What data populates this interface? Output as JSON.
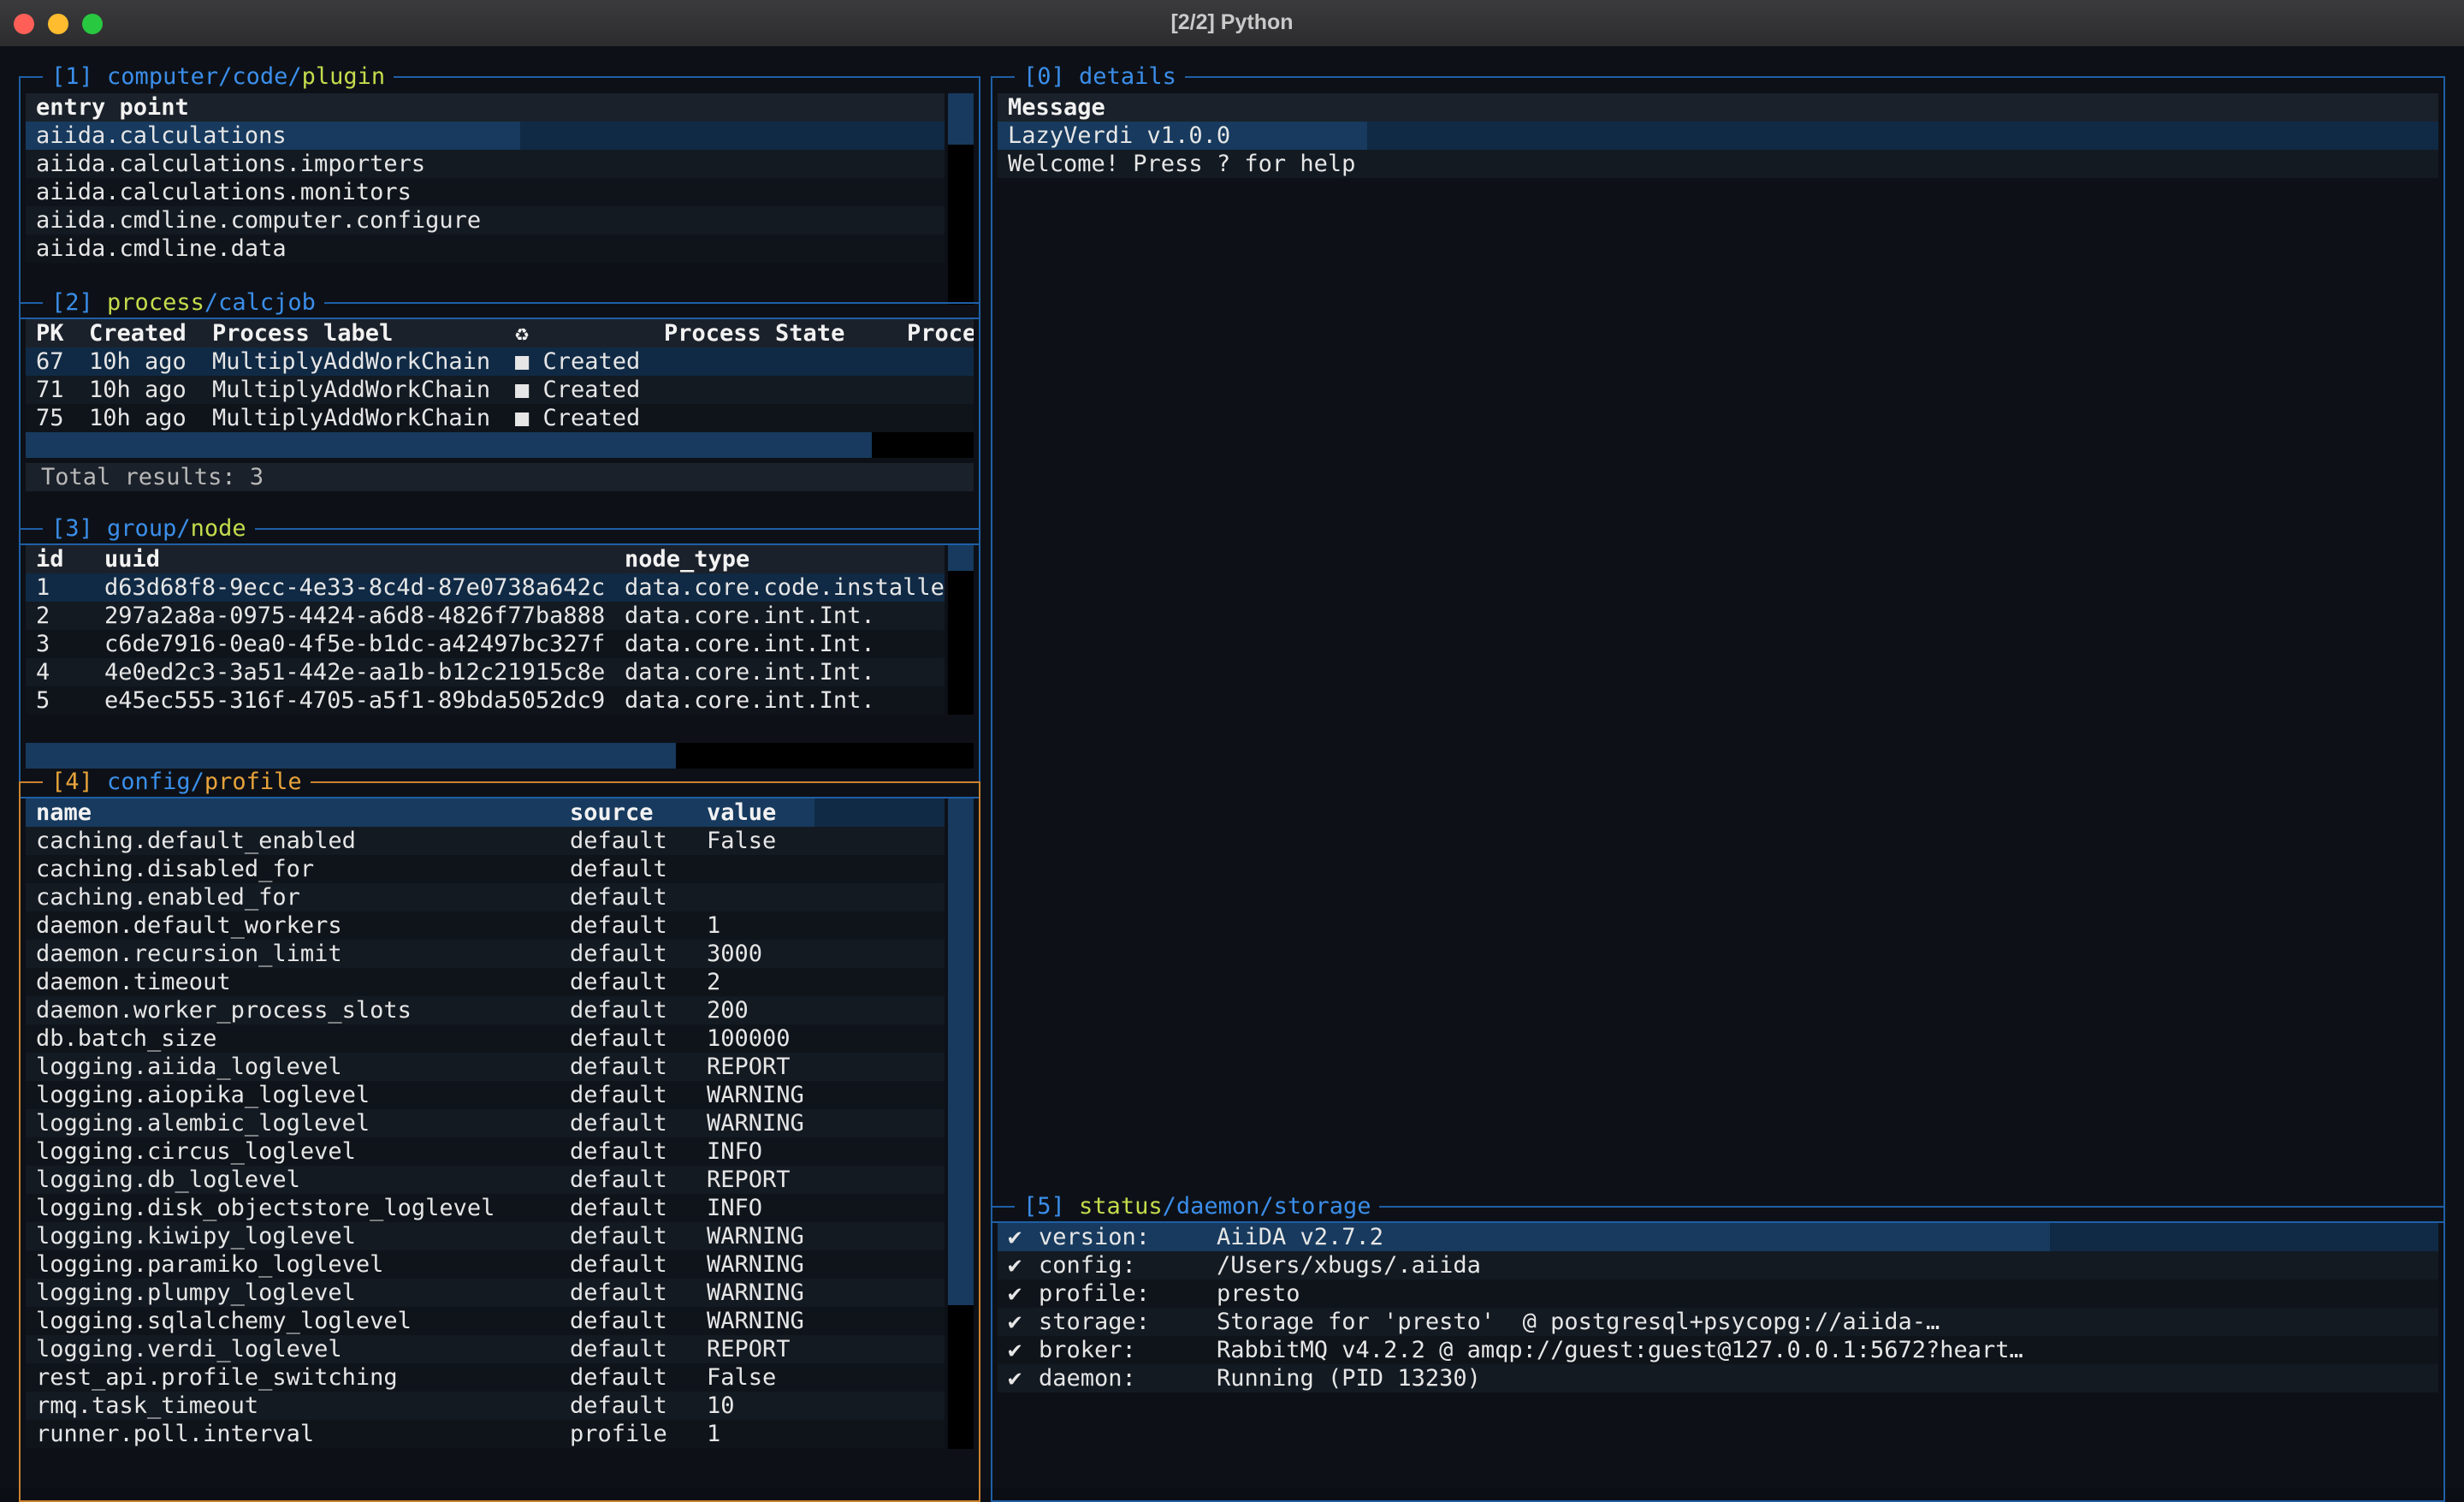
{
  "window": {
    "title": "[2/2] Python"
  },
  "panels": {
    "plugin": {
      "index": "[1]",
      "path": [
        "computer",
        "code",
        "plugin"
      ],
      "header": "entry point",
      "rows": [
        "aiida.calculations",
        "aiida.calculations.importers",
        "aiida.calculations.monitors",
        "aiida.cmdline.computer.configure",
        "aiida.cmdline.data"
      ]
    },
    "process": {
      "index": "[2]",
      "path": [
        "process",
        "calcjob"
      ],
      "columns": [
        "PK",
        "Created",
        "Process label",
        "♻",
        "Process State",
        "Process"
      ],
      "rows": [
        {
          "pk": "67",
          "created": "10h ago",
          "label": "MultiplyAddWorkChain",
          "state": "■ Created"
        },
        {
          "pk": "71",
          "created": "10h ago",
          "label": "MultiplyAddWorkChain",
          "state": "■ Created"
        },
        {
          "pk": "75",
          "created": "10h ago",
          "label": "MultiplyAddWorkChain",
          "state": "■ Created"
        }
      ],
      "total": "Total results: 3"
    },
    "group": {
      "index": "[3]",
      "path": [
        "group",
        "node"
      ],
      "columns": [
        "id",
        "uuid",
        "node_type"
      ],
      "rows": [
        {
          "id": "1",
          "uuid": "d63d68f8-9ecc-4e33-8c4d-87e0738a642c",
          "type": "data.core.code.installe"
        },
        {
          "id": "2",
          "uuid": "297a2a8a-0975-4424-a6d8-4826f77ba888",
          "type": "data.core.int.Int."
        },
        {
          "id": "3",
          "uuid": "c6de7916-0ea0-4f5e-b1dc-a42497bc327f",
          "type": "data.core.int.Int."
        },
        {
          "id": "4",
          "uuid": "4e0ed2c3-3a51-442e-aa1b-b12c21915c8e",
          "type": "data.core.int.Int."
        },
        {
          "id": "5",
          "uuid": "e45ec555-316f-4705-a5f1-89bda5052dc9",
          "type": "data.core.int.Int."
        }
      ]
    },
    "config": {
      "index": "[4]",
      "path": [
        "config",
        "profile"
      ],
      "columns": [
        "name",
        "source",
        "value"
      ],
      "rows": [
        {
          "name": "caching.default_enabled",
          "source": "default",
          "value": "False"
        },
        {
          "name": "caching.disabled_for",
          "source": "default",
          "value": ""
        },
        {
          "name": "caching.enabled_for",
          "source": "default",
          "value": ""
        },
        {
          "name": "daemon.default_workers",
          "source": "default",
          "value": "1"
        },
        {
          "name": "daemon.recursion_limit",
          "source": "default",
          "value": "3000"
        },
        {
          "name": "daemon.timeout",
          "source": "default",
          "value": "2"
        },
        {
          "name": "daemon.worker_process_slots",
          "source": "default",
          "value": "200"
        },
        {
          "name": "db.batch_size",
          "source": "default",
          "value": "100000"
        },
        {
          "name": "logging.aiida_loglevel",
          "source": "default",
          "value": "REPORT"
        },
        {
          "name": "logging.aiopika_loglevel",
          "source": "default",
          "value": "WARNING"
        },
        {
          "name": "logging.alembic_loglevel",
          "source": "default",
          "value": "WARNING"
        },
        {
          "name": "logging.circus_loglevel",
          "source": "default",
          "value": "INFO"
        },
        {
          "name": "logging.db_loglevel",
          "source": "default",
          "value": "REPORT"
        },
        {
          "name": "logging.disk_objectstore_loglevel",
          "source": "default",
          "value": "INFO"
        },
        {
          "name": "logging.kiwipy_loglevel",
          "source": "default",
          "value": "WARNING"
        },
        {
          "name": "logging.paramiko_loglevel",
          "source": "default",
          "value": "WARNING"
        },
        {
          "name": "logging.plumpy_loglevel",
          "source": "default",
          "value": "WARNING"
        },
        {
          "name": "logging.sqlalchemy_loglevel",
          "source": "default",
          "value": "WARNING"
        },
        {
          "name": "logging.verdi_loglevel",
          "source": "default",
          "value": "REPORT"
        },
        {
          "name": "rest_api.profile_switching",
          "source": "default",
          "value": "False"
        },
        {
          "name": "rmq.task_timeout",
          "source": "default",
          "value": "10"
        },
        {
          "name": "runner.poll.interval",
          "source": "profile",
          "value": "1"
        }
      ]
    },
    "details": {
      "index": "[0]",
      "path": [
        "details"
      ],
      "header": "Message",
      "rows": [
        "LazyVerdi v1.0.0",
        "Welcome! Press ? for help"
      ]
    },
    "status": {
      "index": "[5]",
      "path": [
        "status",
        "daemon",
        "storage"
      ],
      "rows": [
        {
          "check": "✔",
          "key": "version:",
          "value": "AiiDA v2.7.2"
        },
        {
          "check": "✔",
          "key": "config:",
          "value": "/Users/xbugs/.aiida"
        },
        {
          "check": "✔",
          "key": "profile:",
          "value": "presto"
        },
        {
          "check": "✔",
          "key": "storage:",
          "value": "Storage for 'presto'  @ postgresql+psycopg://aiida-…"
        },
        {
          "check": "✔",
          "key": "broker:",
          "value": "RabbitMQ v4.2.2 @ amqp://guest:guest@127.0.0.1:5672?heart…"
        },
        {
          "check": "✔",
          "key": "daemon:",
          "value": "Running (PID 13230)"
        }
      ]
    }
  }
}
